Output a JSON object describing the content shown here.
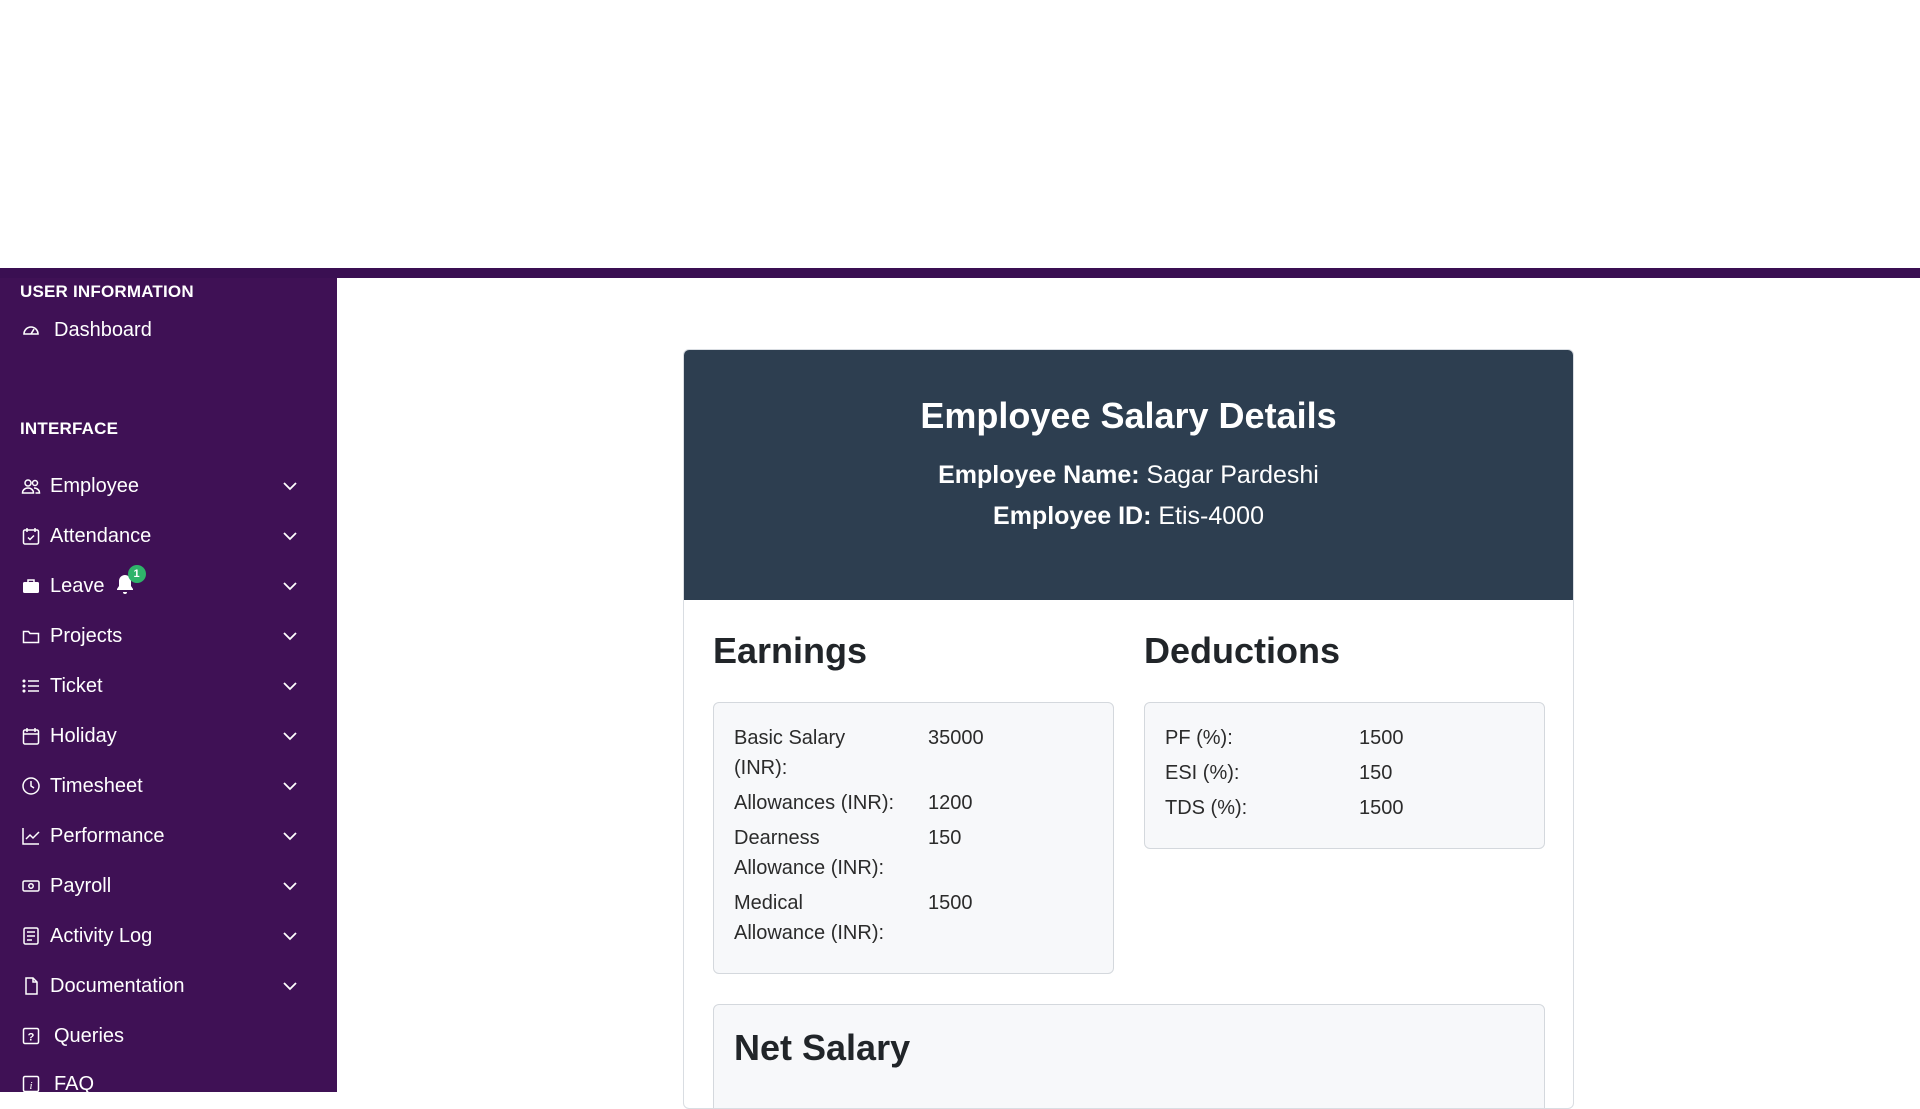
{
  "sidebar": {
    "user_info_heading": "USER INFORMATION",
    "dashboard_label": "Dashboard",
    "interface_heading": "INTERFACE",
    "items": [
      {
        "label": "Employee",
        "icon": "users-icon"
      },
      {
        "label": "Attendance",
        "icon": "calendar-check-icon"
      },
      {
        "label": "Leave",
        "icon": "briefcase-icon",
        "notification_count": "1"
      },
      {
        "label": "Projects",
        "icon": "folder-icon"
      },
      {
        "label": "Ticket",
        "icon": "list-icon"
      },
      {
        "label": "Holiday",
        "icon": "calendar-icon"
      },
      {
        "label": "Timesheet",
        "icon": "clock-icon"
      },
      {
        "label": "Performance",
        "icon": "chart-line-icon"
      },
      {
        "label": "Payroll",
        "icon": "money-icon"
      },
      {
        "label": "Activity Log",
        "icon": "log-icon"
      },
      {
        "label": "Documentation",
        "icon": "file-icon"
      }
    ],
    "queries_label": "Queries",
    "faq_label": "FAQ"
  },
  "salary": {
    "title": "Employee Salary Details",
    "name_label": "Employee Name:",
    "name_value": " Sagar Pardeshi",
    "id_label": "Employee ID:",
    "id_value": " Etis-4000",
    "earnings_heading": "Earnings",
    "deductions_heading": "Deductions",
    "earnings": [
      {
        "label_line1": "Basic Salary",
        "label_line2": "(INR):",
        "value": "35000"
      },
      {
        "label_line1": "Allowances (INR):",
        "label_line2": "",
        "value": "1200"
      },
      {
        "label_line1": "Dearness",
        "label_line2": "Allowance (INR):",
        "value": "150"
      },
      {
        "label_line1": "Medical",
        "label_line2": "Allowance (INR):",
        "value": "1500"
      }
    ],
    "deductions": [
      {
        "label": "PF (%):",
        "value": "1500"
      },
      {
        "label": "ESI (%):",
        "value": "150"
      },
      {
        "label": "TDS (%):",
        "value": "1500"
      }
    ],
    "net_heading": "Net Salary"
  },
  "colors": {
    "sidebar_bg": "#3f1155",
    "card_header_bg": "#2d3e50",
    "badge_green": "#2fb36a"
  }
}
